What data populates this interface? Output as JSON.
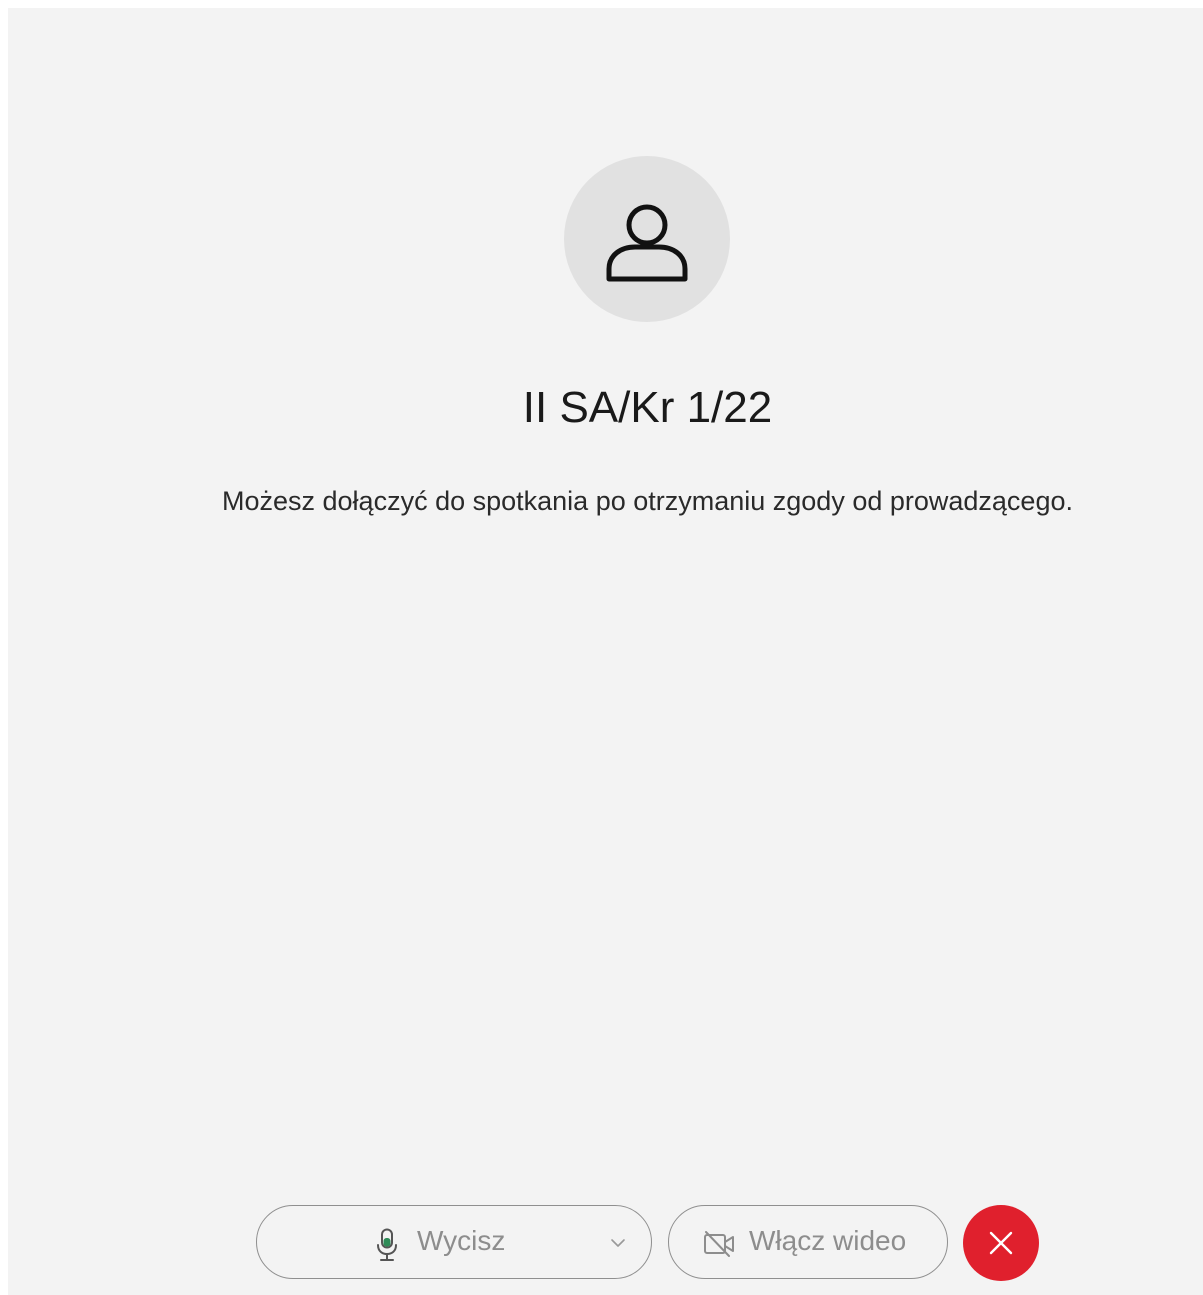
{
  "meeting": {
    "title": "II SA/Kr 1/22",
    "waiting_message": "Możesz dołączyć do spotkania po otrzymaniu zgody od prowadzącego."
  },
  "controls": {
    "mute_label": "Wycisz",
    "video_label": "Włącz wideo",
    "mic_icon": "microphone-icon",
    "video_icon": "video-off-icon",
    "leave_icon": "close-icon",
    "leave_color": "#e0202d",
    "mic_color": "#2e8b57"
  }
}
